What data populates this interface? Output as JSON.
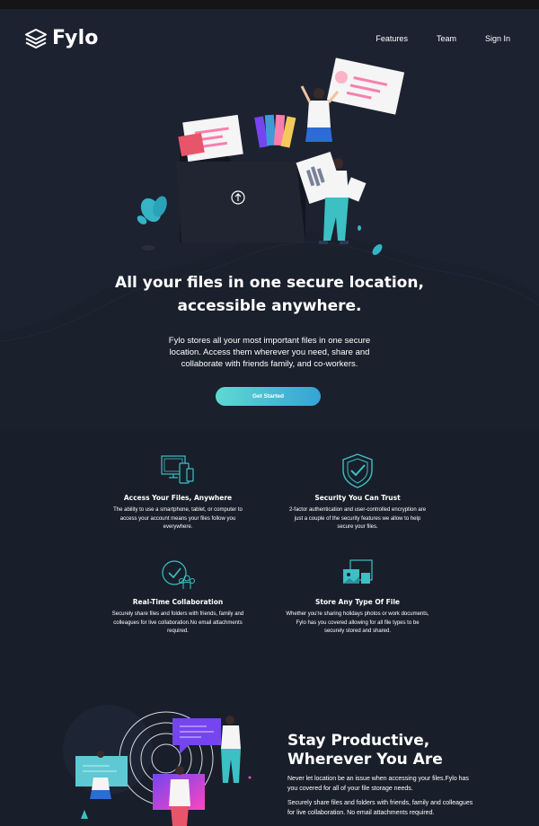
{
  "brand": {
    "name": "Fylo"
  },
  "nav": {
    "features": "Features",
    "team": "Team",
    "signin": "Sign In"
  },
  "hero": {
    "title_line1": "All your files in one secure location,",
    "title_line2": "accessible anywhere.",
    "description": "Fylo stores all your most important files in one secure location. Access them wherever you need, share and collaborate with friends family, and co-workers.",
    "cta": "Get Started"
  },
  "features": [
    {
      "icon": "devices-icon",
      "title": "Access Your Files, Anywhere",
      "text": "The ability to use a smartphone, tablet, or computer to access your account means your files follow you everywhere."
    },
    {
      "icon": "shield-check-icon",
      "title": "Security You Can Trust",
      "text": "2-factor authentication and user-controlled encryption are just a couple of the security features we allow to help secure your files."
    },
    {
      "icon": "collaboration-icon",
      "title": "Real-Time Collaboration",
      "text": "Securely share files and folders with friends, family and colleagues for live collaboration.No email attachments required."
    },
    {
      "icon": "file-types-icon",
      "title": "Store Any Type Of File",
      "text": "Whether you're sharing holidays photos or work documents, Fylo has you covered allowing for all file types to be securely stored and shared."
    }
  ],
  "productive": {
    "title_line1": "Stay Productive,",
    "title_line2": "Wherever You Are",
    "p1": "Never let location be an issue when accessing your files.Fylo has you covered for all of your file storage needs.",
    "p2": "Securely share files and folders with friends, family and colleagues for live collaboration. No email attachments required."
  },
  "colors": {
    "background": "#181f2a",
    "hero_bg": "#1c2230",
    "accent_cyan": "#5ed9d1",
    "accent_blue": "#36a3d6",
    "accent_pink": "#fa7eac",
    "accent_purple": "#7545ef"
  }
}
